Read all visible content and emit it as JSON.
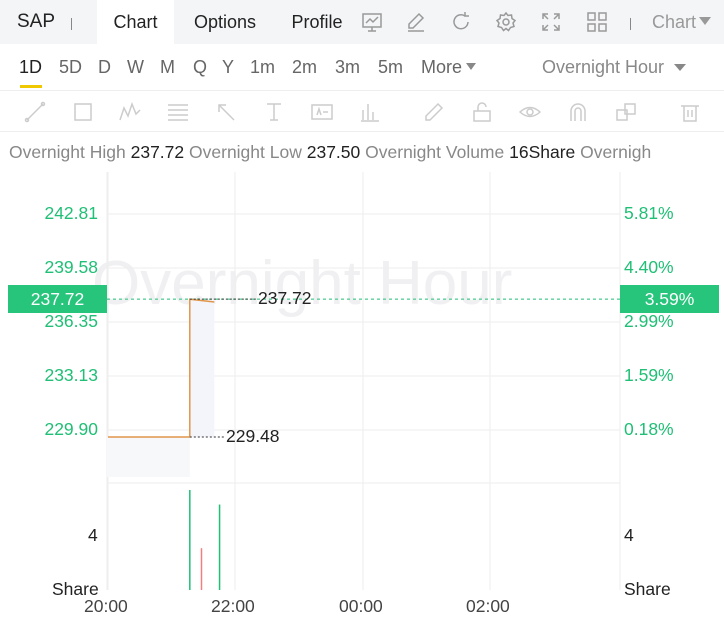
{
  "header": {
    "ticker": "SAP",
    "tabs": [
      {
        "label": "Chart",
        "active": true
      },
      {
        "label": "Options",
        "active": false
      },
      {
        "label": "Profile",
        "active": false
      }
    ],
    "tool_icons": [
      "indicator-icon",
      "draw-icon",
      "refresh-icon",
      "settings-icon",
      "fullscreen-icon",
      "layout-grid-icon"
    ],
    "chart_menu_label": "Chart"
  },
  "periods": {
    "items": [
      "1D",
      "5D",
      "D",
      "W",
      "M",
      "Q",
      "Y",
      "1m",
      "2m",
      "3m",
      "5m"
    ],
    "active": "1D",
    "more_label": "More",
    "session_label": "Overnight Hour"
  },
  "drawing_tools": [
    "trend-line-icon",
    "rectangle-icon",
    "wave-icon",
    "fibonacci-icon",
    "arrow-icon",
    "text-icon",
    "price-label-icon",
    "bar-pattern-icon",
    "pencil-icon",
    "lock-icon",
    "eye-icon",
    "magnet-icon",
    "layers-icon",
    "trash-icon"
  ],
  "stats": {
    "high_label": "Overnight High",
    "high_value": "237.72",
    "low_label": "Overnight Low",
    "low_value": "237.50",
    "volume_label": "Overnight Volume",
    "volume_value": "16Share",
    "trailing_label": "Overnigh"
  },
  "watermark": "Overnight Hour",
  "colors": {
    "up": "#1fbf75",
    "badge": "#27c47b",
    "line": "#e0964a",
    "down": "#f08080",
    "accent": "#f0c800"
  },
  "chart_data": {
    "type": "line",
    "y_left_ticks": [
      "242.81",
      "239.58",
      "236.35",
      "233.13",
      "229.90"
    ],
    "y_right_ticks": [
      "5.81%",
      "4.40%",
      "2.99%",
      "1.59%",
      "0.18%"
    ],
    "current_price": "237.72",
    "current_pct": "3.59%",
    "high_annotation": "237.72",
    "low_annotation": "229.48",
    "x_ticks": [
      "20:00",
      "22:00",
      "00:00",
      "02:00"
    ],
    "ylim": [
      229.48,
      244.0
    ],
    "price_series": [
      {
        "t": "20:00",
        "v": 229.48
      },
      {
        "t": "21:17",
        "v": 229.48
      },
      {
        "t": "21:17",
        "v": 237.72
      },
      {
        "t": "21:40",
        "v": 237.55
      }
    ],
    "volume": {
      "unit_label": "Share",
      "tick_label": "4",
      "bars": [
        {
          "t": "21:17",
          "v": 5.5,
          "dir": "up"
        },
        {
          "t": "21:28",
          "v": 2.3,
          "dir": "down"
        },
        {
          "t": "21:45",
          "v": 4.7,
          "dir": "up"
        }
      ],
      "ylim": [
        0,
        5.5
      ]
    }
  }
}
